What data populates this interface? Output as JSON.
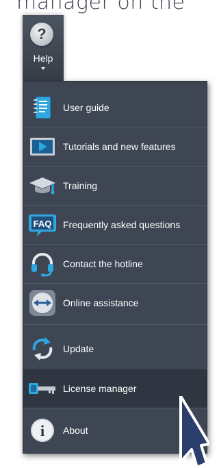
{
  "caption": "manager on the",
  "help_button": {
    "label": "Help",
    "icon": "question-circle-icon"
  },
  "menu": {
    "items": [
      {
        "label": "User guide",
        "icon": "user-guide-icon"
      },
      {
        "label": "Tutorials and new features",
        "icon": "tutorial-play-icon"
      },
      {
        "label": "Training",
        "icon": "graduation-cap-icon"
      },
      {
        "label": "Frequently asked questions",
        "icon": "faq-icon",
        "icon_text": "FAQ"
      },
      {
        "label": "Contact the hotline",
        "icon": "headset-icon"
      },
      {
        "label": "Online assistance",
        "icon": "remote-assistance-icon"
      },
      {
        "label": "Update",
        "icon": "update-arrows-icon"
      },
      {
        "label": "License manager",
        "icon": "license-key-icon",
        "highlighted": true
      },
      {
        "label": "About",
        "icon": "info-icon",
        "icon_text": "i"
      }
    ]
  },
  "colors": {
    "menu_bg": "#3e4654",
    "highlight_bg": "#2f3641",
    "separator": "#535b68",
    "text": "#ffffff",
    "icon_accent": "#2fa8df"
  }
}
